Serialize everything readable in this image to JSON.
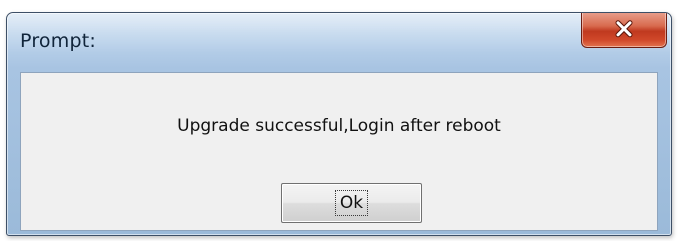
{
  "window": {
    "title": "Prompt:",
    "close_icon": "close-icon"
  },
  "dialog": {
    "message": "Upgrade successful,Login after reboot",
    "ok_label": "Ok"
  },
  "colors": {
    "close_button": "#c94a30",
    "title_bar": "#b9d1ea",
    "client_background": "#f0f0f0"
  }
}
